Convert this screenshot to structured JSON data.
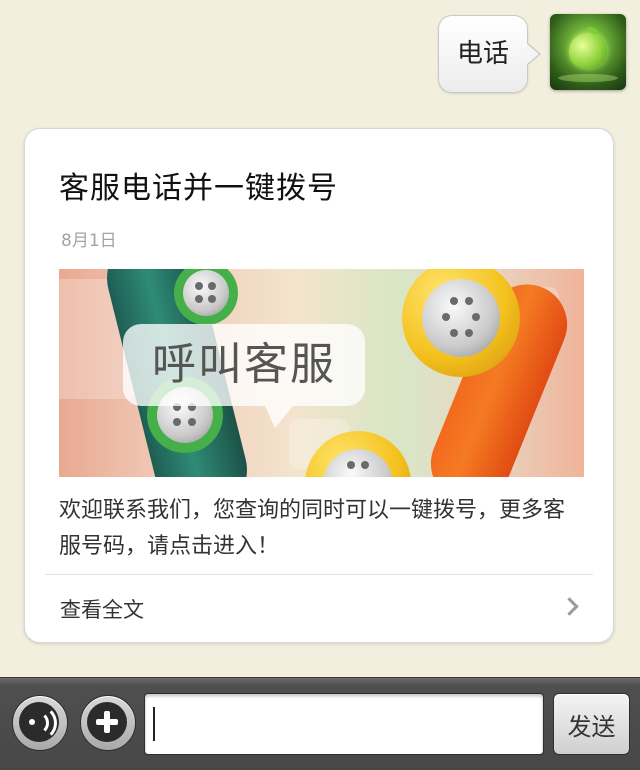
{
  "chat": {
    "sent_message": "电话"
  },
  "article": {
    "title": "客服电话并一键拨号",
    "date": "8月1日",
    "banner_text": "呼叫客服",
    "description": "欢迎联系我们，您查询的同时可以一键拨号，更多客服号码，请点击进入！",
    "read_more": "查看全文"
  },
  "toolbar": {
    "input_value": "",
    "send_label": "发送"
  },
  "icons": {
    "avatar": "green-apple-avatar",
    "voice": "voice-wave-icon",
    "plus": "plus-icon",
    "read_more": "chevron-right-icon"
  },
  "colors": {
    "background": "#f3efdf",
    "card": "#ffffff",
    "toolbar": "#4a4a4a",
    "date_text": "#a3a3a3"
  }
}
